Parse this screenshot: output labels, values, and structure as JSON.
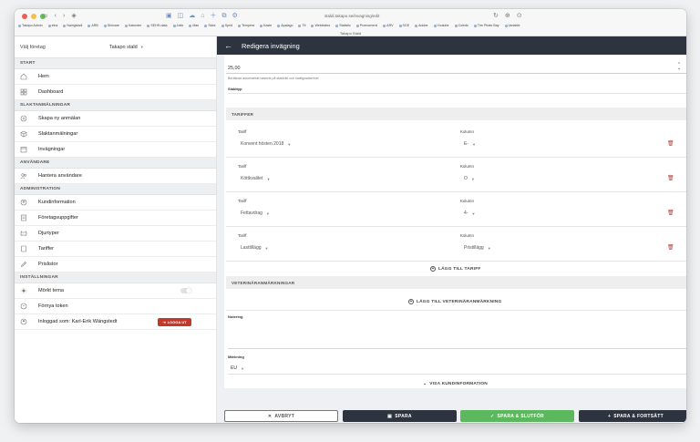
{
  "browser": {
    "url": "staldi.takapo.se/invagning/edit",
    "tab_title": "Takapo Stald",
    "bookmarks": [
      "Takapo Admin",
      "elna",
      "Naingstadl",
      "ARB",
      "Skrivare",
      "Kalender",
      "SEHH-data",
      "Jobb",
      "Man",
      "Sidor",
      "Sprid",
      "Tempera",
      "Kaste",
      "Apalago",
      "Tlt",
      "Webbsites",
      "Statistic",
      "Promomersi",
      "ARV",
      "SGE",
      "Adobe",
      "Youtube",
      "Coleds",
      "The Pirate Bay",
      "Variable"
    ]
  },
  "sidebar": {
    "company_label": "Välj företag",
    "company_value": "Takapo stald",
    "sections": {
      "start": "START",
      "slakt": "SLAKTANMÄLNINGAR",
      "users": "ANVÄNDARE",
      "admin": "ADMINISTRATION",
      "settings": "INSTÄLLNINGAR"
    },
    "items": {
      "home": "Hem",
      "dashboard": "Dashboard",
      "create": "Skapa ny anmälan",
      "slaktanmalningar": "Slaktanmälningar",
      "invagningar": "Invägningar",
      "users": "Hantera användare",
      "kundinfo": "Kundinformation",
      "foretag": "Företagsuppgifter",
      "djurtyper": "Djurtyper",
      "tariffer": "Tariffer",
      "prislistor": "Prislistor",
      "dark": "Mörkt tema",
      "token": "Förnya token",
      "logged": "Inloggad som: Karl-Erik Wängstedt"
    },
    "logout": "LOGGA UT"
  },
  "main": {
    "title": "Redigera invägning",
    "value": "25,00",
    "note": "Beräknas automatiskt baserat på slaktvikt och slaktgradsenhet",
    "slakttyp": "Slakttyp",
    "tariffs_header": "TARIFFER",
    "col_tariff": "Tariff",
    "col_kolumn": "Kolumn",
    "tariffs": [
      {
        "tariff": "Konvent hösten 2018",
        "kolumn": "E-"
      },
      {
        "tariff": "Köttkvalitet",
        "kolumn": "O"
      },
      {
        "tariff": "Fettavdrag",
        "kolumn": "4-"
      },
      {
        "tariff": "Lasttillägg",
        "kolumn": "Pristillägg"
      }
    ],
    "add_tariff": "LÄGG TILL TARIFF",
    "vet_header": "VETERINÄRANMÄRKNINGAR",
    "add_vet": "LÄGG TILL VETERINÄRANMÄRKNING",
    "notering": "Notering",
    "markning": "Märkning",
    "markning_value": "EU",
    "show_customer": "VISA KUNDINFORMATION"
  },
  "buttons": {
    "cancel": "AVBRYT",
    "save": "SPARA",
    "save_finish": "SPARA & SLUTFÖR",
    "save_continue": "SPARA & FORTSÄTT"
  },
  "colors": {
    "header": "#2d3440",
    "dark_button": "#2d3440",
    "green_button": "#5cb85c",
    "logout": "#c0392b",
    "trash": "#c0392b"
  }
}
